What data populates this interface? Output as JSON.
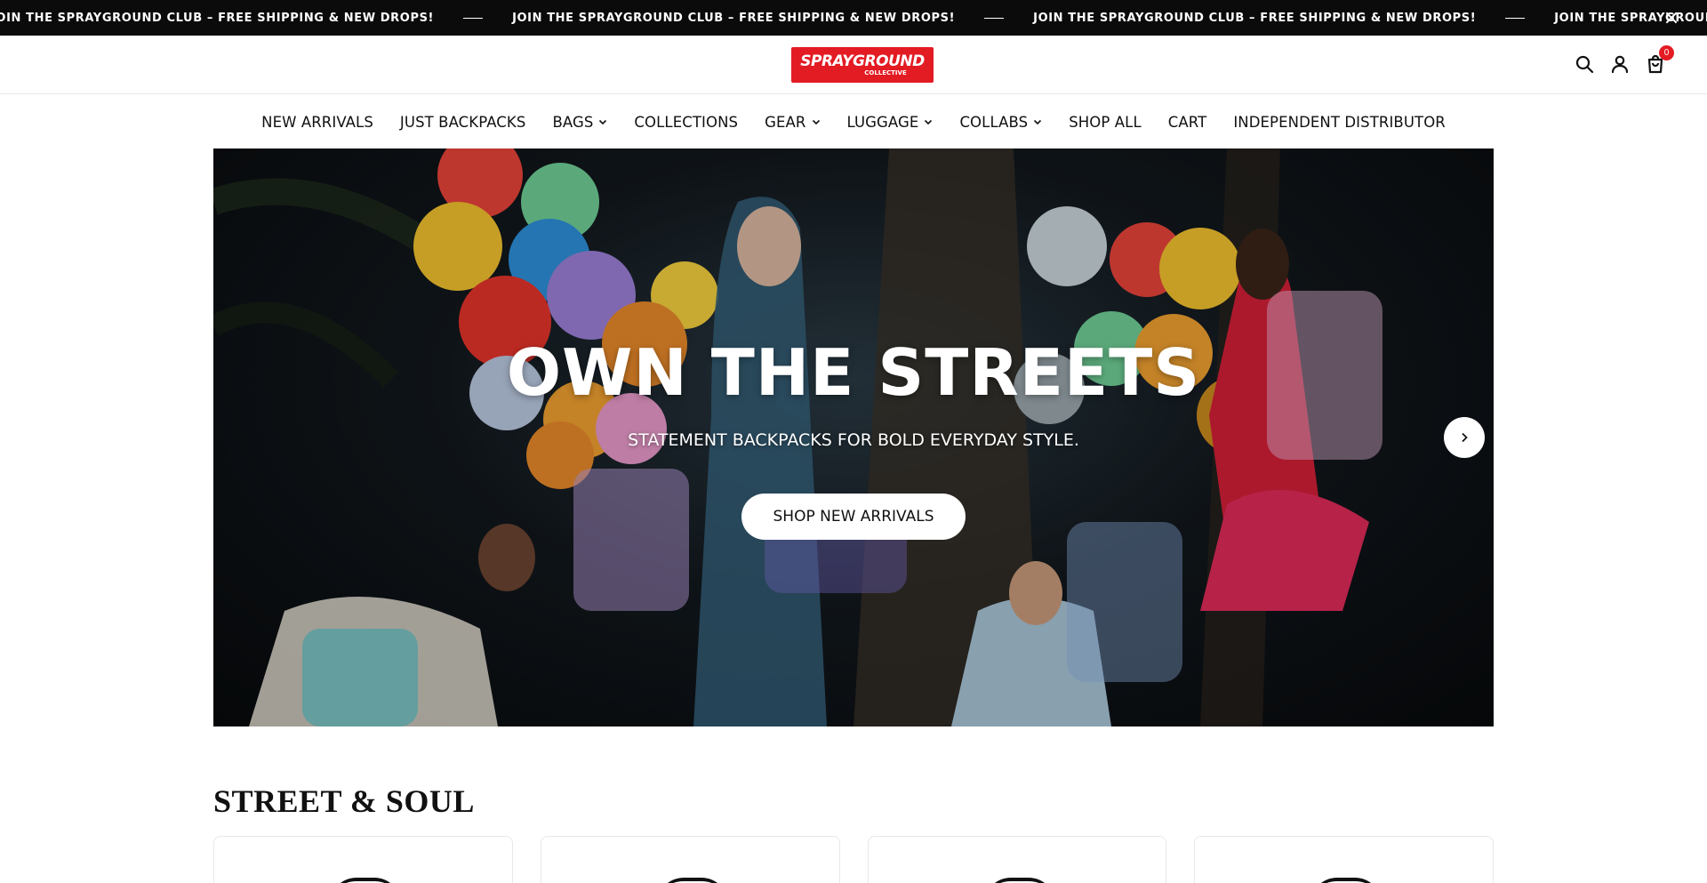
{
  "announcement": {
    "messages": [
      "JOIN THE SPRAYGROUND CLUB – FREE SHIPPING & NEW DROPS!",
      "JOIN THE SPRAYGROUND CLUB – FREE SHIPPING & NEW DROPS!",
      "JOIN THE SPRAYGROUND CLUB – FREE SHIPPING & NEW DROPS!",
      "JOIN THE SPRAYGROUND CLUB – FREE SHIPPING & NEW DROP"
    ],
    "close_icon": "close-icon"
  },
  "header": {
    "logo_text": "SPRAYGROUND",
    "logo_sub": "COLLECTIVE",
    "logo_color": "#e31b23",
    "icons": [
      "search-icon",
      "account-icon",
      "cart-icon"
    ],
    "cart_count": "0"
  },
  "nav": {
    "items": [
      {
        "label": "NEW ARRIVALS",
        "dropdown": false
      },
      {
        "label": "JUST BACKPACKS",
        "dropdown": false
      },
      {
        "label": "BAGS",
        "dropdown": true
      },
      {
        "label": "COLLECTIONS",
        "dropdown": false
      },
      {
        "label": "GEAR",
        "dropdown": true
      },
      {
        "label": "LUGGAGE",
        "dropdown": true
      },
      {
        "label": "COLLABS",
        "dropdown": true
      },
      {
        "label": "SHOP ALL",
        "dropdown": false
      },
      {
        "label": "CART",
        "dropdown": false
      },
      {
        "label": "INDEPENDENT DISTRIBUTOR",
        "dropdown": false
      }
    ]
  },
  "hero": {
    "title": "OWN THE STREETS",
    "subtitle": "STATEMENT BACKPACKS FOR BOLD EVERYDAY STYLE.",
    "cta_label": "SHOP NEW ARRIVALS",
    "next_icon": "chevron-right-icon"
  },
  "section": {
    "title": "STREET & SOUL",
    "card_count": 4
  }
}
